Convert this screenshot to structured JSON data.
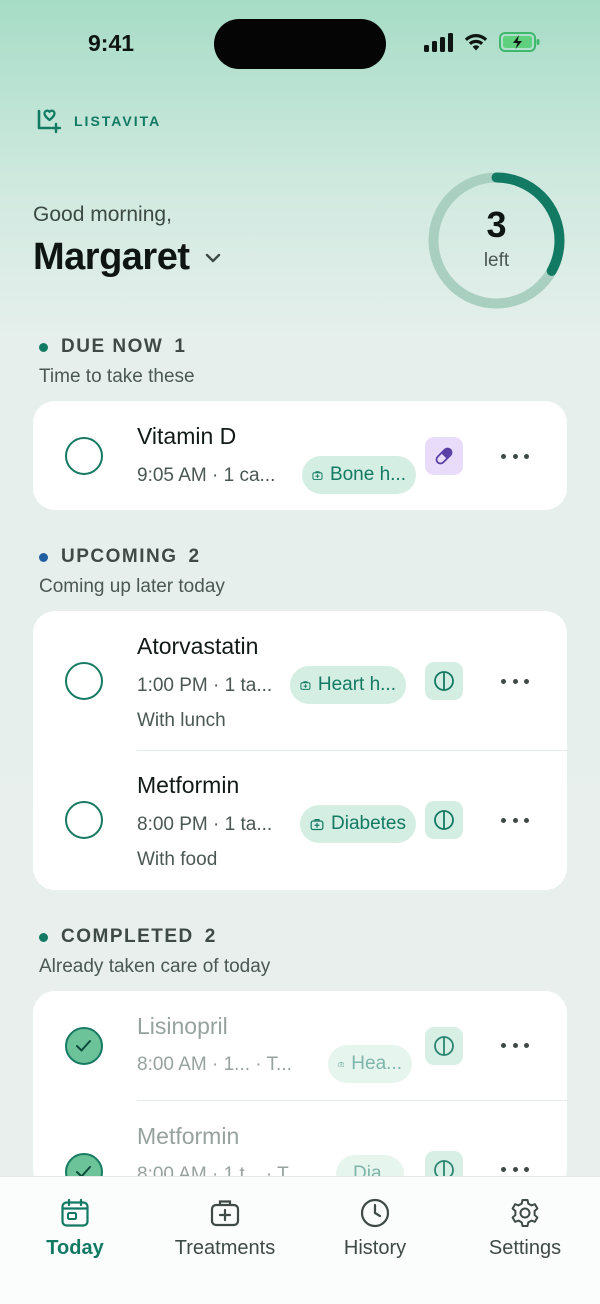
{
  "status_bar": {
    "time": "9:41"
  },
  "brand": {
    "name": "LISTAVITA"
  },
  "greeting": {
    "text": "Good morning,",
    "user": "Margaret"
  },
  "progress": {
    "count": "3",
    "label": "left",
    "fraction_complete": 0.33
  },
  "colors": {
    "accent": "#127a63",
    "due_dot": "#127a63",
    "upcoming_dot": "#1e5fa0",
    "completed_dot": "#127a63",
    "pill_badge": "#e9dcfa"
  },
  "sections": {
    "due": {
      "title": "DUE NOW",
      "count": "1",
      "subtitle": "Time to take these",
      "items": [
        {
          "name": "Vitamin D",
          "meta": "9:05 AM · 1 ca...",
          "chip": "Bone h...",
          "type_icon": "pill-icon",
          "note": ""
        }
      ]
    },
    "upcoming": {
      "title": "UPCOMING",
      "count": "2",
      "subtitle": "Coming up later today",
      "items": [
        {
          "name": "Atorvastatin",
          "meta": "1:00 PM · 1 ta...",
          "chip": "Heart h...",
          "type_icon": "tablet-icon",
          "note": "With lunch"
        },
        {
          "name": "Metformin",
          "meta": "8:00 PM · 1 ta...",
          "chip": "Diabetes",
          "type_icon": "tablet-icon",
          "note": "With food"
        }
      ]
    },
    "completed": {
      "title": "COMPLETED",
      "count": "2",
      "subtitle": "Already taken care of today",
      "items": [
        {
          "name": "Lisinopril",
          "meta": "8:00 AM · 1... · T...",
          "chip": "Hea...",
          "type_icon": "tablet-icon",
          "note": ""
        },
        {
          "name": "Metformin",
          "meta": "8:00 AM · 1 t... · T...",
          "chip": "Dia...",
          "type_icon": "tablet-icon",
          "note": ""
        }
      ]
    }
  },
  "tabs": [
    {
      "label": "Today",
      "icon": "calendar-icon",
      "active": true
    },
    {
      "label": "Treatments",
      "icon": "medical-kit-icon",
      "active": false
    },
    {
      "label": "History",
      "icon": "clock-icon",
      "active": false
    },
    {
      "label": "Settings",
      "icon": "gear-icon",
      "active": false
    }
  ]
}
